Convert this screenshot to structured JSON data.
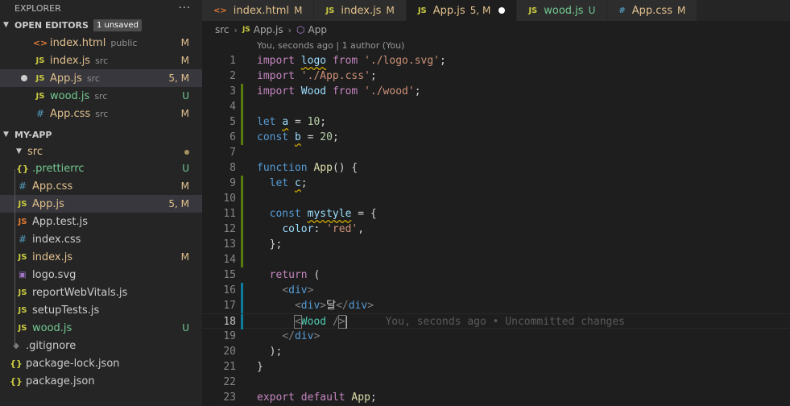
{
  "sidebar": {
    "title": "EXPLORER",
    "more_label": "···",
    "open_editors": {
      "label": "OPEN EDITORS",
      "badge": "1 unsaved",
      "items": [
        {
          "name": "index.html",
          "desc": "public",
          "status": "M",
          "icon": "html-icon",
          "icon_glyph": "<>"
        },
        {
          "name": "index.js",
          "desc": "src",
          "status": "M",
          "icon": "js-icon",
          "icon_glyph": "JS"
        },
        {
          "name": "App.js",
          "desc": "src",
          "status": "5, M",
          "icon": "js-icon",
          "icon_glyph": "JS"
        },
        {
          "name": "wood.js",
          "desc": "src",
          "status": "U",
          "icon": "js-icon",
          "icon_glyph": "JS"
        },
        {
          "name": "App.css",
          "desc": "src",
          "status": "M",
          "icon": "css-icon",
          "icon_glyph": "#"
        }
      ]
    },
    "project": {
      "label": "MY-APP",
      "src_folder": "src",
      "src_items": [
        {
          "name": ".prettierrc",
          "status": "U",
          "icon": "json-icon",
          "icon_glyph": "{}"
        },
        {
          "name": "App.css",
          "status": "M",
          "icon": "css-icon",
          "icon_glyph": "#"
        },
        {
          "name": "App.js",
          "status": "5, M",
          "icon": "js-icon",
          "icon_glyph": "JS"
        },
        {
          "name": "App.test.js",
          "status": "",
          "icon": "test-icon",
          "icon_glyph": "JS"
        },
        {
          "name": "index.css",
          "status": "",
          "icon": "css-icon",
          "icon_glyph": "#"
        },
        {
          "name": "index.js",
          "status": "M",
          "icon": "js-icon",
          "icon_glyph": "JS"
        },
        {
          "name": "logo.svg",
          "status": "",
          "icon": "svg-icon",
          "icon_glyph": "▣"
        },
        {
          "name": "reportWebVitals.js",
          "status": "",
          "icon": "js-icon",
          "icon_glyph": "JS"
        },
        {
          "name": "setupTests.js",
          "status": "",
          "icon": "js-icon",
          "icon_glyph": "JS"
        },
        {
          "name": "wood.js",
          "status": "U",
          "icon": "js-icon",
          "icon_glyph": "JS"
        }
      ],
      "root_items": [
        {
          "name": ".gitignore",
          "icon": "git-icon",
          "icon_glyph": "◆"
        },
        {
          "name": "package-lock.json",
          "icon": "json-icon",
          "icon_glyph": "{}"
        },
        {
          "name": "package.json",
          "icon": "json-icon",
          "icon_glyph": "{}"
        }
      ]
    }
  },
  "tabs": [
    {
      "name": "index.html",
      "status": "M",
      "icon_glyph": "<>"
    },
    {
      "name": "index.js",
      "status": "M",
      "icon_glyph": "JS"
    },
    {
      "name": "App.js",
      "status": "5, M",
      "icon_glyph": "JS"
    },
    {
      "name": "wood.js",
      "status": "U",
      "icon_glyph": "JS"
    },
    {
      "name": "App.css",
      "status": "M",
      "icon_glyph": "#"
    }
  ],
  "breadcrumb": {
    "folder": "src",
    "file": "App.js",
    "symbol": "App"
  },
  "editor": {
    "blame_header": "You, seconds ago | 1 author (You)",
    "inline_blame": "You, seconds ago • Uncommitted changes",
    "current_line": 18,
    "line_numbers": [
      "1",
      "2",
      "3",
      "4",
      "5",
      "6",
      "7",
      "8",
      "9",
      "10",
      "11",
      "12",
      "13",
      "14",
      "15",
      "16",
      "17",
      "18",
      "19",
      "20",
      "21",
      "22",
      "23"
    ]
  },
  "colors": {
    "modified": "#e2c08d",
    "untracked": "#73c991",
    "gutter_added": "#587c0c",
    "gutter_modified": "#0c7d9d"
  }
}
